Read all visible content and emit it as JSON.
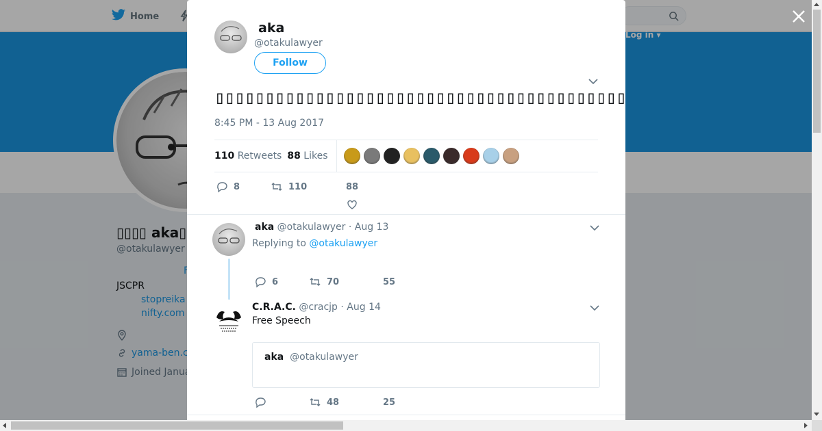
{
  "background_page": {
    "nav_home_label": "Home",
    "login_label": "Log in ▾",
    "profile_name": "▯▯▯▯ aka▯",
    "profile_handle": "@otakulawyer",
    "bio_line1": "JSCPR",
    "bio_link1": "stopreika",
    "bio_link2": "nifty.com",
    "website": "yama-ben.c",
    "joined": "Joined Janua"
  },
  "modal": {
    "close_label": "×",
    "tweet": {
      "author_name": "aka",
      "author_handle": "@otakulawyer",
      "follow_label": "Follow",
      "text": "▯▯▯▯▯▯▯▯▯▯▯▯▯▯▯▯▯▯▯▯▯▯▯▯▯▯▯▯▯▯▯▯▯▯▯▯▯▯▯▯▯▯▯▯▯▯▯▯▯▯",
      "timestamp": "8:45 PM - 13 Aug 2017",
      "retweets_count": "110",
      "retweets_label": "Retweets",
      "likes_count": "88",
      "likes_label": "Likes",
      "likers": [
        "#c89a1a",
        "#7a7a7a",
        "#222222",
        "#e8c060",
        "#2a5a6a",
        "#3a2a2a",
        "#d83a1a",
        "#a8d0e8",
        "#c8a080"
      ],
      "actions": {
        "reply": "8",
        "retweet": "110",
        "like": "88"
      }
    },
    "replies": [
      {
        "name": "aka",
        "handle": "@otakulawyer",
        "date": "· Aug 13",
        "replying_prefix": "Replying to",
        "replying_to": "@otakulawyer",
        "actions": {
          "reply": "6",
          "retweet": "70",
          "like": "55"
        }
      },
      {
        "name": "C.R.A.C.",
        "handle": "@cracjp",
        "date": "· Aug 14",
        "text": "Free Speech",
        "quote_name": "aka",
        "quote_handle": "@otakulawyer",
        "actions": {
          "reply": "",
          "retweet": "48",
          "like": "25"
        }
      }
    ]
  },
  "colors": {
    "brand_blue": "#1da1f2",
    "banner_blue": "#1b95e0",
    "muted_text": "#657786"
  }
}
